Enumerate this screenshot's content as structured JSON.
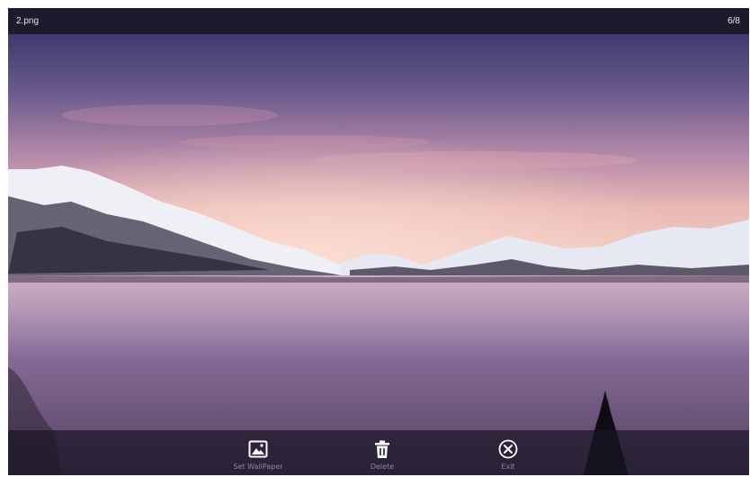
{
  "viewer": {
    "filename": "2.png",
    "counter": "6/8",
    "image_description_icon": "landscape-photo"
  },
  "actions": {
    "set_wallpaper": {
      "label": "Set WallPaper",
      "icon": "image-icon"
    },
    "delete": {
      "label": "Delete",
      "icon": "trash-icon"
    },
    "exit": {
      "label": "Exit",
      "icon": "close-circle-icon"
    }
  },
  "colors": {
    "topbar": "#1c1a2c",
    "bottombar": "#191626",
    "label": "#8c8aa0",
    "icon": "#ffffff"
  }
}
